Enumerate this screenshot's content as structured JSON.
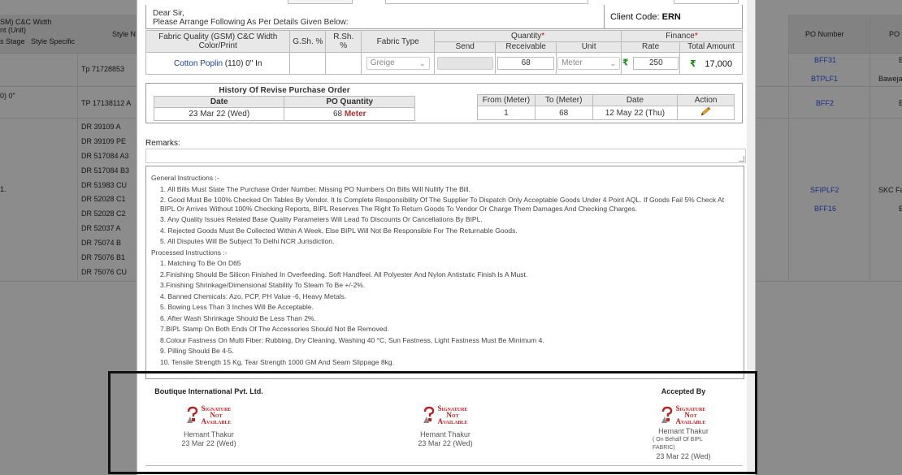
{
  "background": {
    "left_headers": {
      "line1": "SM) C&C Width",
      "line2": "nt (Unit)",
      "col_a": "s Stage",
      "col_b": "Style Specific",
      "col_c": "Style N"
    },
    "right_headers": {
      "po_number": "PO Number",
      "po": "PO"
    },
    "row_values": {
      "r2_left": "0) 0\""
    },
    "styles": [
      "Tp 71728853",
      "TP 17138112 A",
      "DR 39109 A",
      "DR 39109 PE",
      "DR 517084 A3",
      "DR 517084 B3",
      "DR 51983 CU",
      "DR 52028 C1",
      "DR 52028 C2",
      "DR 52037 A",
      "DR 75074 B",
      "DR 75076 B1",
      "DR 75076 CU"
    ],
    "po_numbers": [
      "BFF31",
      "BTPLF1",
      "BFF2",
      "SFIPLF2",
      "BFF16"
    ],
    "right_edge": [
      "E",
      "Baweja",
      "E",
      "SKC Fa",
      "E"
    ],
    "marker": "1."
  },
  "letter": {
    "greeting": "Dear Sir,",
    "instruction": "Please Arrange Following As Per Details Given Below:",
    "client_code_label": "Client Code:",
    "client_code": "ERN"
  },
  "item_table": {
    "headers": {
      "fabric_quality": "Fabric Quality (GSM) C&C Width Color/Print",
      "gsh": "G.Sh. %",
      "rsh": "R.Sh. %",
      "fabric_type": "Fabric Type",
      "quantity": "Quantity",
      "finance": "Finance",
      "send": "Send",
      "receivable": "Receivable",
      "unit": "Unit",
      "rate": "Rate",
      "total_amount": "Total Amount"
    },
    "row": {
      "fabric_link": "Cotton Poplin",
      "fabric_spec": "(110) 0\" In",
      "fabric_type": "Greige",
      "send": "",
      "receivable": "68",
      "unit": "Meter",
      "rate": "250",
      "total": "17,000",
      "currency_symbol": "₹"
    }
  },
  "history": {
    "title": "History Of Revise Purchase Order",
    "headers": {
      "date": "Date",
      "po_quantity": "PO Quantity"
    },
    "rows": [
      {
        "date": "23 Mar 22 (Wed)",
        "qty": "68",
        "unit": "Meter"
      }
    ]
  },
  "range_table": {
    "headers": {
      "from": "From (Meter)",
      "to": "To (Meter)",
      "date": "Date",
      "action": "Action"
    },
    "rows": [
      {
        "from": "1",
        "to": "68",
        "date": "12 May 22 (Thu)"
      }
    ]
  },
  "remarks": {
    "label": "Remarks:",
    "value": ""
  },
  "instructions": {
    "general_title": "General Instructions :-",
    "general": [
      "1. All Bills Must State The Purchase Order Number. Missing PO Numbers On Bills Will Nullify The Bill.",
      "2. Good Must Be 100% Checked On Tables By Vendor. It Is Complete Responsibility Of The Supplier To Dispatch Only Acceptable Goods Under 4 Point AQL. If Goods Fail 5% Check At BIPL Or Arrives Without 100% Checking Reports, BIPL Reserves The Right To Return Goods To Vendor Or Charge Them Damages And Checking Charges.",
      "3. Any Quality Issues Related Base Quality Parameters Will Lead To Discounts Or Cancellations By BIPL.",
      "4. Rejected Goods Must Be Collected Within A Week, Else BIPL Will Not Be Responsible For The Returnable Goods.",
      "5. All Disputes Will Be Subject To Delhi NCR Jurisdiction."
    ],
    "processed_title": "Processed Instructions :-",
    "processed": [
      "1. Matching To Be On D65",
      "2.Finishing Should Be Silicon Finished In Overfeeding. Soft Handfeel. All Polyester And Nylon Antistatic Finish Is A Must.",
      "3.Finishing Shrinkage/Dimensional Stability To Steam To Be +/-2%.",
      "4. Banned Chemicals: Azo, PCP, PH Value -6, Heavy Metals.",
      "5. Bowing Less Than 3 Inches Will Be Acceptable.",
      "6. After Wash Shrinkage Should Be Less Than 2%.",
      "7.BIPL Stamp On Both Ends Of The Accessories Should Not Be Removed.",
      "8.Colour Fastness On Multi Fiber: Rubbing, Dry Cleaning, Washing 40 °C, Sun Fastness, Light Fastness Must Be Minimum 4.",
      "9. Pilling Should Be 4-5.",
      "10. Tensile Strength 15 Kg, Tear Strength 1000 GM And Seam Slippage 8kg."
    ]
  },
  "signatures": {
    "company": "Boutique International Pvt. Ltd.",
    "accepted_by": "Accepted By",
    "sig_line1": "Signature",
    "sig_line2": "Not",
    "sig_line3": "Available",
    "left": {
      "name": "Hemant Thakur",
      "date": "23 Mar 22 (Wed)"
    },
    "center": {
      "name": "Hemant Thakur",
      "date": "23 Mar 22 (Wed)"
    },
    "right": {
      "name": "Hemant Thakur",
      "note": "( On Behalf Of BIPL FABRIC)",
      "date": "23 Mar 22 (Wed)"
    }
  },
  "colors": {
    "link": "#1a3fa0",
    "required": "#dd0000",
    "rupee": "#1a8a1a",
    "signature": "#b22222"
  }
}
